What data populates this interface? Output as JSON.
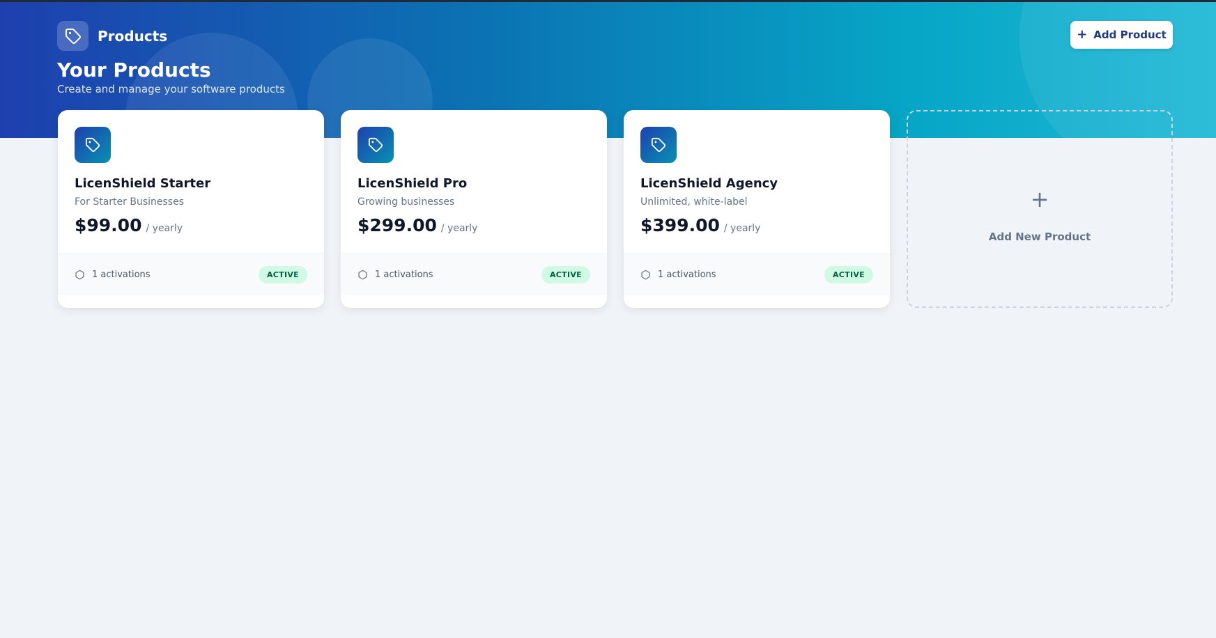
{
  "header": {
    "section_label": "Products",
    "title": "Your Products",
    "subtitle": "Create and manage your software products",
    "add_button_label": "Add Product"
  },
  "products": [
    {
      "name": "LicenShield Starter",
      "description": "For Starter Businesses",
      "price": "$99.00",
      "period": "/ yearly",
      "activations": "1 activations",
      "status": "ACTIVE"
    },
    {
      "name": "LicenShield Pro",
      "description": "Growing businesses",
      "price": "$299.00",
      "period": "/ yearly",
      "activations": "1 activations",
      "status": "ACTIVE"
    },
    {
      "name": "LicenShield Agency",
      "description": "Unlimited, white-label",
      "price": "$399.00",
      "period": "/ yearly",
      "activations": "1 activations",
      "status": "ACTIVE"
    }
  ],
  "new_product": {
    "label": "Add New Product",
    "icon": "plus-icon"
  },
  "icons": {
    "brand": "tag-icon",
    "product": "tag-icon",
    "activations": "hexagon-icon",
    "add": "plus-icon"
  },
  "colors": {
    "hero_start": "#1e40af",
    "hero_end": "#1fb8d6",
    "active_badge_bg": "#d1fae5",
    "active_badge_text": "#065f46",
    "page_bg": "#f0f3f8"
  }
}
